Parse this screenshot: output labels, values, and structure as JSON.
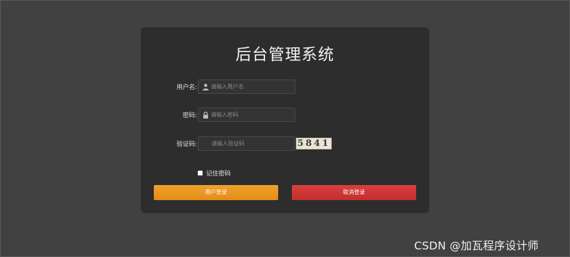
{
  "login": {
    "title": "后台管理系统",
    "username": {
      "label": "用户名:",
      "placeholder": "请输入用户名",
      "icon": "user-icon"
    },
    "password": {
      "label": "密码:",
      "placeholder": "请输入密码",
      "icon": "lock-icon"
    },
    "captcha": {
      "label": "验证码:",
      "placeholder": "请输入验证码",
      "code": "5841"
    },
    "remember_label": "记住密码",
    "login_button": "用户登录",
    "cancel_button": "取消登录"
  },
  "watermark": "CSDN @加瓦程序设计师",
  "colors": {
    "page_background": "#414141",
    "panel_background": "#2d2d2d",
    "login_button": "#e8961f",
    "cancel_button": "#cf3737"
  }
}
